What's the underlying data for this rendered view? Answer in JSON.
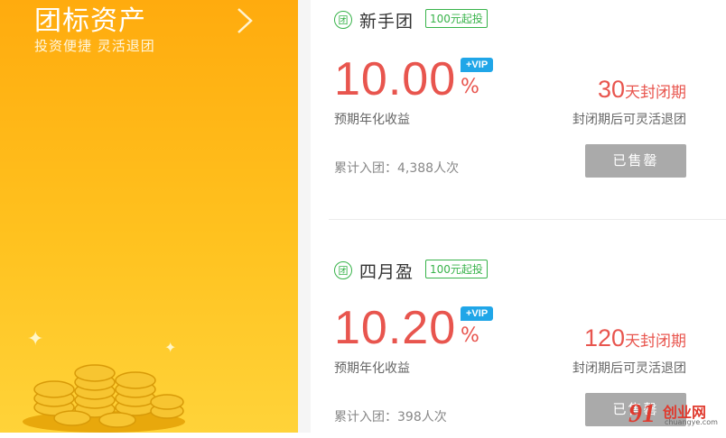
{
  "left_panel": {
    "title": "团标资产",
    "subtitle": "投资便捷 灵活退团",
    "arrow_icon": "chevron-right-icon"
  },
  "products": [
    {
      "icon_text": "团",
      "name": "新手团",
      "min_badge": "100元起投",
      "rate": "10.00",
      "rate_unit": "%",
      "vip_badge": "+VIP",
      "rate_label": "预期年化收益",
      "term_number": "30",
      "term_unit": "天封闭期",
      "term_note": "封闭期后可灵活退团",
      "count": "累计入团：4,388人次",
      "button_label": "已售罄"
    },
    {
      "icon_text": "团",
      "name": "四月盈",
      "min_badge": "100元起投",
      "rate": "10.20",
      "rate_unit": "%",
      "vip_badge": "+VIP",
      "rate_label": "预期年化收益",
      "term_number": "120",
      "term_unit": "天封闭期",
      "term_note": "封闭期后可灵活退团",
      "count": "累计入团：398人次",
      "button_label": "已售罄"
    }
  ],
  "watermark": {
    "logo": "91",
    "name": "创业网",
    "url": "chuangye.com"
  },
  "colors": {
    "orange_panel": "#ffb012",
    "rate_red": "#e8554e",
    "accent_green": "#38b34a",
    "vip_blue": "#20a6e8",
    "button_gray": "#aaaaaa"
  }
}
